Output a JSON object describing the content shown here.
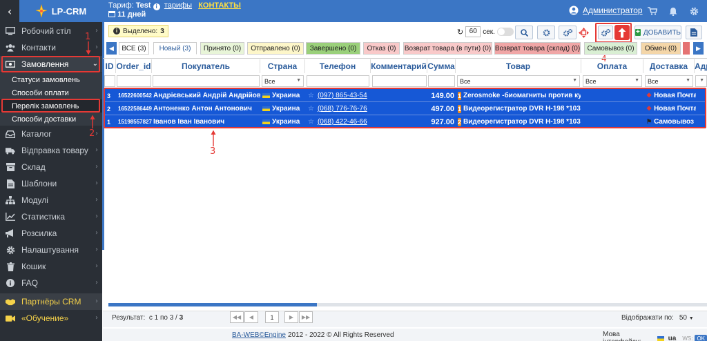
{
  "brand": {
    "name": "LP-CRM"
  },
  "header": {
    "tariff_label": "Тариф:",
    "tariff_name": "Test",
    "tariffs_link": "тарифы",
    "contacts_link": "КОНТАКТЫ",
    "days_left": "11 дней",
    "user_name": "Администратор"
  },
  "sidebar": {
    "items": [
      {
        "label": "Робочий стіл",
        "icon": "monitor-icon"
      },
      {
        "label": "Контакти",
        "icon": "users-icon"
      },
      {
        "label": "Замовлення",
        "icon": "money-icon"
      },
      {
        "label": "Каталог",
        "icon": "inbox-icon"
      },
      {
        "label": "Відправка товару",
        "icon": "truck-icon"
      },
      {
        "label": "Склад",
        "icon": "box-icon"
      },
      {
        "label": "Шаблони",
        "icon": "file-icon"
      },
      {
        "label": "Модулі",
        "icon": "sitemap-icon"
      },
      {
        "label": "Статистика",
        "icon": "chart-icon"
      },
      {
        "label": "Розсилка",
        "icon": "bullhorn-icon"
      },
      {
        "label": "Налаштування",
        "icon": "gear-icon"
      },
      {
        "label": "Кошик",
        "icon": "trash-icon"
      },
      {
        "label": "FAQ",
        "icon": "info-icon"
      },
      {
        "label": "Партнёры CRM",
        "icon": "handshake-icon"
      },
      {
        "label": "«Обучение»",
        "icon": "video-icon"
      }
    ],
    "submenu": [
      "Статуси замовлень",
      "Способи оплати",
      "Перелік замовлень",
      "Способи доставки"
    ]
  },
  "annotations": {
    "n1": "1",
    "n2": "2",
    "n3": "3",
    "n4": "4"
  },
  "toolbar": {
    "selected_label": "Выделено:",
    "selected_count": "3",
    "refresh_value": "60",
    "refresh_unit": "сек.",
    "add_label": "ДОБАВИТЬ"
  },
  "tabs": [
    {
      "label": "ВСЕ (3)",
      "bg": "#ffffff"
    },
    {
      "label": "Новый (3)",
      "bg": "#ffffff"
    },
    {
      "label": "Принято (0)",
      "bg": "#e8f5d8"
    },
    {
      "label": "Отправлено (0)",
      "bg": "#fdf6c9"
    },
    {
      "label": "Завершено (0)",
      "bg": "#9ad07a"
    },
    {
      "label": "Отказ (0)",
      "bg": "#f9c9c9"
    },
    {
      "label": "Возврат товара (в пути) (0)",
      "bg": "#f9c9c9"
    },
    {
      "label": "Возврат товара (склад) (0)",
      "bg": "#f0a6a6"
    },
    {
      "label": "Самовывоз (0)",
      "bg": "#d9efd3"
    },
    {
      "label": "Обмен (0)",
      "bg": "#f4d6a8"
    }
  ],
  "table": {
    "columns": [
      "ID",
      "Order_id",
      "Покупатель",
      "Страна",
      "Телефон",
      "Комментарий",
      "Сумма",
      "Товар",
      "Оплата",
      "Доставка",
      "Адр"
    ],
    "filter_all": "Все",
    "rows": [
      {
        "id": "3",
        "order_id": "16522600542",
        "buyer": "Андрієвський Андрій Андрійов...",
        "country": "Украина",
        "phone": "(097) 865-43-54",
        "sum": "149.00",
        "qty": "1",
        "product": "Zerosmoke -биомагниты против кур...",
        "delivery": "Новая Почта"
      },
      {
        "id": "2",
        "order_id": "16522586449",
        "buyer": "Антоненко Антон Антонович",
        "country": "Украина",
        "phone": "(068) 776-76-76",
        "sum": "497.00",
        "qty": "1",
        "product": "Видеорегистратор DVR H-198 *1035...",
        "delivery": "Новая Почта"
      },
      {
        "id": "1",
        "order_id": "15198557827",
        "buyer": "Іванов Іван Іванович",
        "country": "Украина",
        "phone": "(068) 422-46-66",
        "sum": "927.00",
        "qty": "2",
        "product": "Видеорегистратор DVR H-198 *1035...",
        "delivery": "Самовывоз"
      }
    ]
  },
  "footer": {
    "result_label": "Результат:",
    "result_text": "с 1 по 3 /",
    "result_total": "3",
    "page": "1",
    "per_page_label": "Відображати по:",
    "per_page": "50",
    "copyright_link": "BA-WEB©Engine",
    "copyright_text": "2012 - 2022 © All Rights Reserved",
    "lang_label": "Мова інтерфейсу:",
    "lang": "ua",
    "ws_label": "WS:",
    "ws_status": "OK"
  }
}
